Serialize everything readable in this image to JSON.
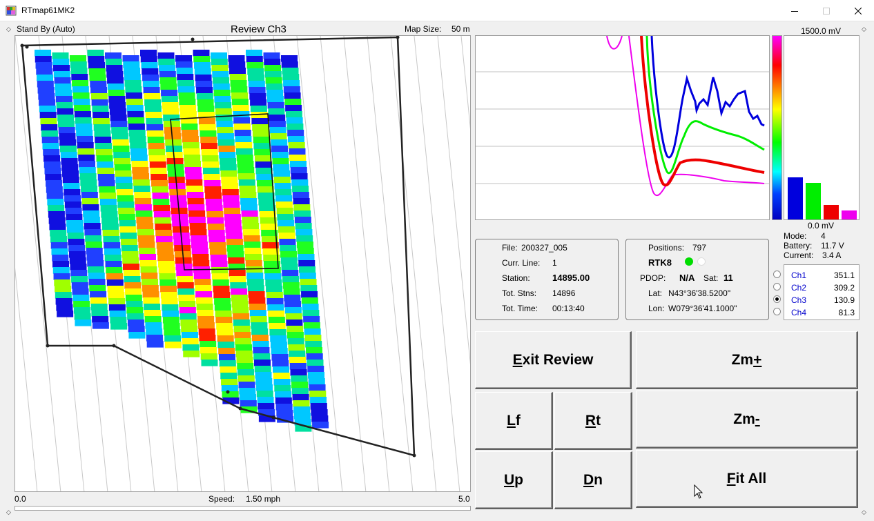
{
  "window": {
    "title": "RTmap61MK2",
    "minimize_icon": "minimize-icon",
    "maximize_icon": "maximize-icon",
    "close_icon": "close-icon"
  },
  "map": {
    "mode": "Stand By (Auto)",
    "title": "Review Ch3",
    "size_label": "Map Size:",
    "size_value": "50 m",
    "scale_min": "0.0",
    "scale_max": "5.0",
    "speed_label": "Speed:",
    "speed_value": "1.50 mph"
  },
  "graph": {
    "max_label": "1500.0 mV",
    "min_label": "0.0 mV",
    "series": [
      {
        "channel": "Ch1",
        "color": "#0000dd",
        "level": 0.23
      },
      {
        "channel": "Ch2",
        "color": "#00ee00",
        "level": 0.2
      },
      {
        "channel": "Ch3",
        "color": "#ee0000",
        "level": 0.08
      },
      {
        "channel": "Ch4",
        "color": "#ee00ee",
        "level": 0.05
      }
    ]
  },
  "status": {
    "mode_label": "Mode:",
    "mode_value": "4",
    "battery_label": "Battery:",
    "battery_value": "11.7 V",
    "current_label": "Current:",
    "current_value": "3.4 A"
  },
  "file_info": {
    "file_label": "File:",
    "file_value": "200327_005",
    "line_label": "Curr. Line:",
    "line_value": "1",
    "station_label": "Station:",
    "station_value": "14895.00",
    "stns_label": "Tot. Stns:",
    "stns_value": "14896",
    "time_label": "Tot. Time:",
    "time_value": "00:13:40"
  },
  "gps": {
    "positions_label": "Positions:",
    "positions_value": "797",
    "rtk_label": "RTK8",
    "rtk_dot_colors": [
      "#00dd00",
      "#ffffff"
    ],
    "pdop_label": "PDOP:",
    "pdop_value": "N/A",
    "sat_label": "Sat:",
    "sat_value": "11",
    "lat_label": "Lat:",
    "lat_value": "N43°36'38.5200\"",
    "lon_label": "Lon:",
    "lon_value": "W079°36'41.1000\""
  },
  "channels": [
    {
      "name": "Ch1",
      "value": "351.1",
      "selected": false
    },
    {
      "name": "Ch2",
      "value": "309.2",
      "selected": false
    },
    {
      "name": "Ch3",
      "value": "130.9",
      "selected": true
    },
    {
      "name": "Ch4",
      "value": "81.3",
      "selected": false
    }
  ],
  "buttons": {
    "exit_review": {
      "mnemonic": "E",
      "rest": "xit Review"
    },
    "zoom_in": {
      "text": "Zm",
      "mnemonic": "+"
    },
    "left": {
      "mnemonic": "L",
      "rest": "f"
    },
    "right": {
      "mnemonic": "R",
      "rest": "t"
    },
    "zoom_out": {
      "text": "Zm",
      "mnemonic": "-"
    },
    "up": {
      "mnemonic": "U",
      "rest": "p"
    },
    "down": {
      "mnemonic": "D",
      "rest": "n"
    },
    "fit_all": {
      "mnemonic": "F",
      "rest": "it All"
    }
  },
  "colors": {
    "window_bg": "#f0f0f0",
    "accent_blue": "#0000cc"
  }
}
